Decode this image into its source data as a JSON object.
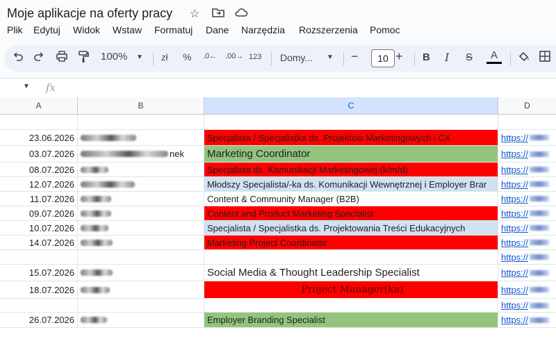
{
  "doc": {
    "title": "Moje aplikacje na oferty pracy"
  },
  "menu": [
    "Plik",
    "Edytuj",
    "Widok",
    "Wstaw",
    "Formatuj",
    "Dane",
    "Narzędzia",
    "Rozszerzenia",
    "Pomoc"
  ],
  "toolbar": {
    "zoom": "100%",
    "currency": "zł",
    "percent": "%",
    "dec_decrease": ".0←",
    "dec_increase": ".00→",
    "number_format": "123",
    "font": "Domy...",
    "font_size": "10",
    "bold": "B",
    "italic": "I",
    "strike": "S",
    "text_color": "A"
  },
  "formula": {
    "fx": "fx"
  },
  "columns": [
    "A",
    "B",
    "C",
    "D"
  ],
  "rows": [
    {
      "date": "",
      "title": "",
      "style": "",
      "link": ""
    },
    {
      "date": "23.06.2026",
      "title": "Specjalista / Specjalistka ds. Projektów Marketingowych i CX",
      "style": "red",
      "link": "https://"
    },
    {
      "date": "03.07.2026",
      "title": "Marketing Coordinator",
      "style": "green big",
      "link": "https://",
      "b_suffix": "nek"
    },
    {
      "date": "08.07.2026",
      "title": "Specjalista ds. Komunikacji Marketingowej (k/m/d)",
      "style": "red",
      "link": "https://"
    },
    {
      "date": "12.07.2026",
      "title": "Młodszy Specjalista/-ka ds. Komunikacji Wewnętrznej i Employer Brar",
      "style": "blue",
      "link": "https://"
    },
    {
      "date": "11.07.2026",
      "title": "Content & Community Manager (B2B)",
      "style": "",
      "link": "https://"
    },
    {
      "date": "09.07.2026",
      "title": "Content and Product Marketing Specialist",
      "style": "red",
      "link": "https://"
    },
    {
      "date": "10.07.2026",
      "title": "Specjalista / Specjalistka ds. Projektowania Treści Edukacyjnych",
      "style": "blue",
      "link": "https://"
    },
    {
      "date": "14.07.2026",
      "title": "Marketing Project Coordinator",
      "style": "red",
      "link": "https://"
    },
    {
      "date": "",
      "title": "",
      "style": "",
      "link": "https://"
    },
    {
      "date": "15.07.2026",
      "title": "Social Media & Thought Leadership Specialist",
      "style": "big",
      "link": "https://"
    },
    {
      "date": "18.07.2026",
      "title": "Project Manager(ka)",
      "style": "red serif",
      "link": "https://"
    },
    {
      "date": "",
      "title": "",
      "style": "",
      "link": "https://"
    },
    {
      "date": "26.07.2026",
      "title": "Employer Branding Specialist",
      "style": "green",
      "link": "https://"
    }
  ]
}
